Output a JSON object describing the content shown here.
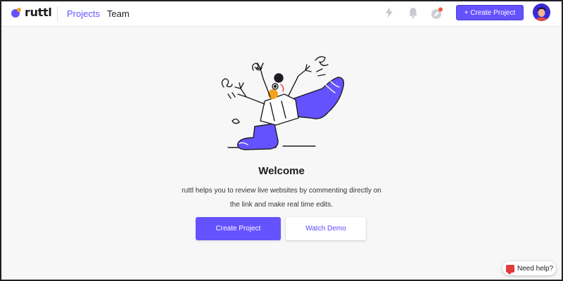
{
  "app": {
    "logo_text": "ruttl"
  },
  "nav": {
    "projects_label": "Projects",
    "team_label": "Team"
  },
  "toolbar": {
    "create_project_label": "+ Create Project",
    "icons": [
      "lightning-icon",
      "bell-icon",
      "rocket-icon"
    ]
  },
  "main": {
    "welcome_title": "Welcome",
    "description_line1": "ruttl helps you to review live websites by commenting directly on",
    "description_line2": "the link and make real time edits.",
    "create_project_label": "Create Project",
    "watch_demo_label": "Watch Demo"
  },
  "help": {
    "label": "Need help?"
  },
  "colors": {
    "accent": "#6552ff",
    "background": "#f7f7f8",
    "topbar": "#ffffff",
    "help_icon": "#e03b3b",
    "illustration_accent": "#f2a321"
  }
}
